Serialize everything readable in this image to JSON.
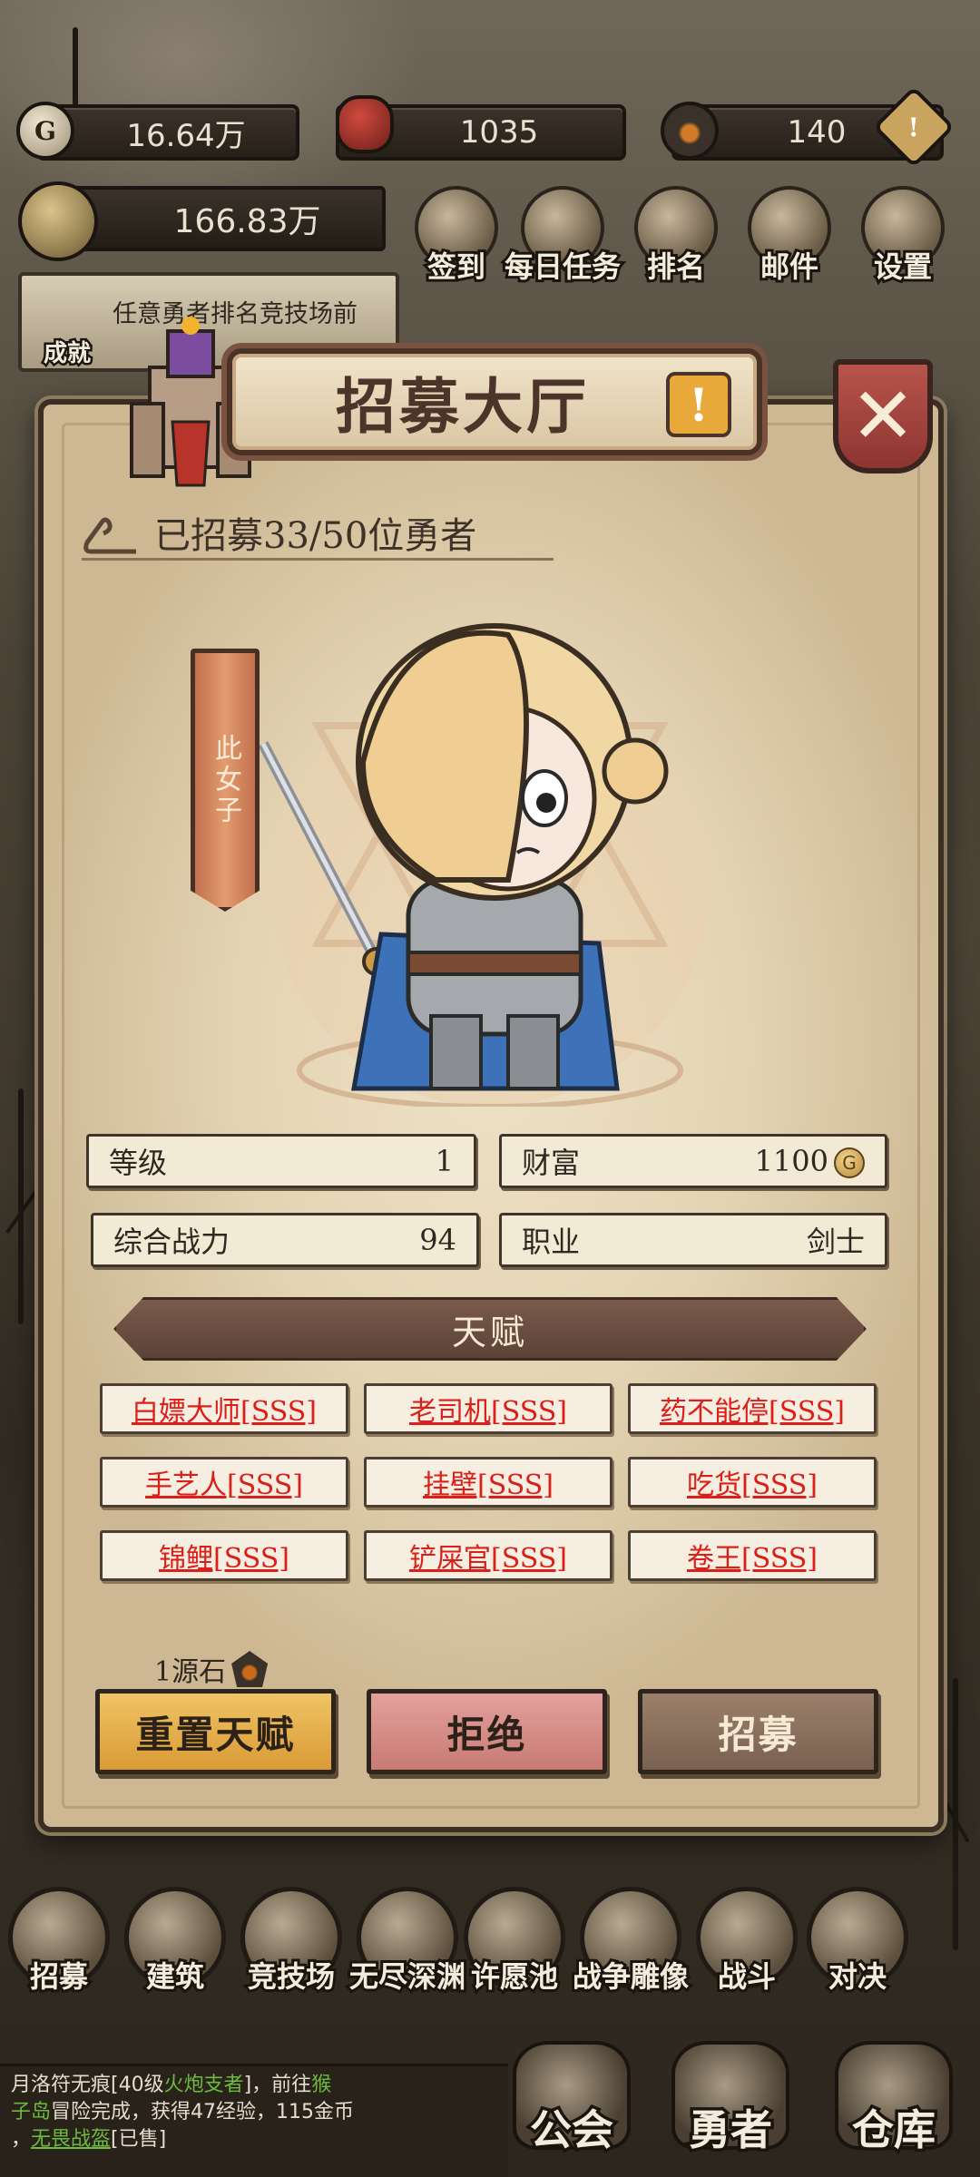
{
  "resources": {
    "gold": "16.64万",
    "medals": "1035",
    "stones": "140",
    "power": "166.83万"
  },
  "top_menu": [
    "签到",
    "每日任务",
    "排名",
    "邮件",
    "设置"
  ],
  "quest": {
    "text": "任意勇者排名竞技场前",
    "achievement_label": "成就"
  },
  "dialog": {
    "title": "招募大厅",
    "recruited": "已招募33/50位勇者",
    "hero_name": "此女子",
    "stats": {
      "level_label": "等级",
      "level": "1",
      "wealth_label": "财富",
      "wealth": "1100",
      "power_label": "综合战力",
      "power": "94",
      "class_label": "职业",
      "class": "剑士"
    },
    "talent_header": "天赋",
    "talents": [
      "白嫖大师[SSS]",
      "老司机[SSS]",
      "药不能停[SSS]",
      "手艺人[SSS]",
      "挂壁[SSS]",
      "吃货[SSS]",
      "锦鲤[SSS]",
      "铲屎官[SSS]",
      "卷王[SSS]"
    ],
    "reset_cost": "1源石",
    "buttons": {
      "reset": "重置天赋",
      "reject": "拒绝",
      "recruit": "招募"
    }
  },
  "bottom_nav": [
    "招募",
    "建筑",
    "竞技场",
    "无尽深渊",
    "许愿池",
    "战争雕像",
    "战斗",
    "对决"
  ],
  "big_nav": [
    "公会",
    "勇者",
    "仓库"
  ],
  "chat": {
    "line1_a": "月洛符无痕[40级",
    "line1_b": "火炮支者",
    "line1_c": "]，前往",
    "line1_d": "猴",
    "line2_a": "子岛",
    "line2_b": "冒险完成，获得47经验，115金币",
    "line3_a": "，",
    "line3_b": "无畏战盔",
    "line3_c": "[已售]"
  },
  "colors": {
    "talent_text": "#d9201a",
    "reset_btn": "#e8b04a",
    "reject_btn": "#d88a86",
    "recruit_btn": "#8a7057"
  }
}
